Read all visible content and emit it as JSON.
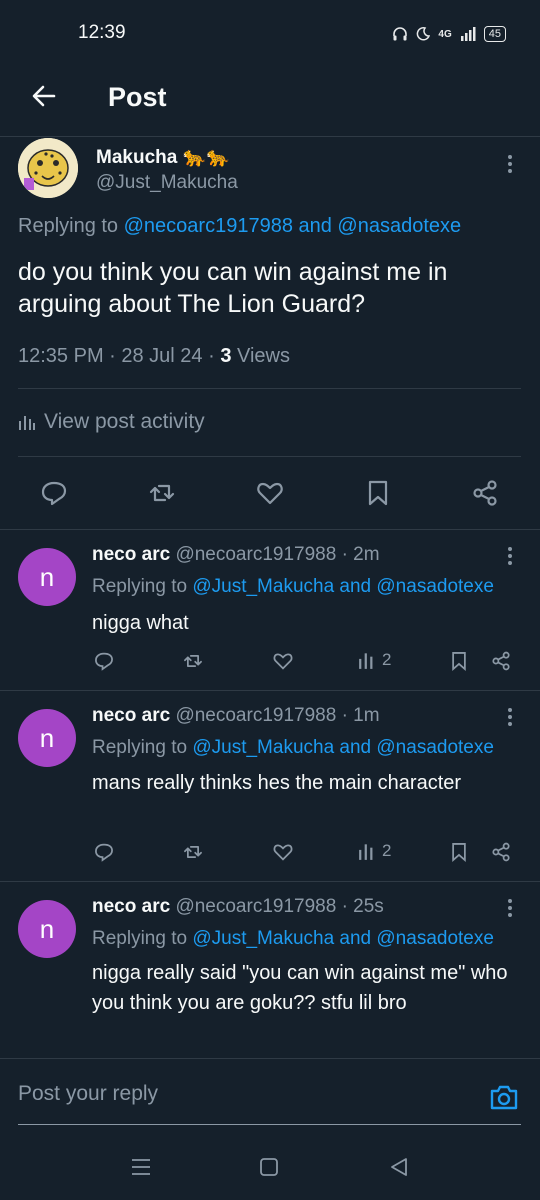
{
  "status_bar": {
    "time": "12:39",
    "network": "4G",
    "battery": "45"
  },
  "header": {
    "title": "Post",
    "back_icon": "back-arrow-icon"
  },
  "main_post": {
    "author_name": "Makucha 🐆🐆",
    "author_handle": "@Just_Makucha",
    "replying_prefix": "Replying to ",
    "replying_to": "@necoarc1917988 and @nasadotexe",
    "text": "do you think you can win against me in arguing about The Lion Guard?",
    "timestamp": "12:35 PM · 28 Jul 24 · ",
    "views_count": "3",
    "views_label": " Views",
    "activity_label": "View post activity"
  },
  "replies": [
    {
      "avatar_letter": "n",
      "name": "neco arc",
      "handle_time": "@necoarc1917988 · 2m",
      "replying_prefix": "Replying to ",
      "replying_to": "@Just_Makucha and @nasadotexe",
      "text": "nigga what",
      "views": "2"
    },
    {
      "avatar_letter": "n",
      "name": "neco arc",
      "handle_time": "@necoarc1917988 · 1m",
      "replying_prefix": "Replying to ",
      "replying_to": "@Just_Makucha and @nasadotexe",
      "text": "mans really thinks hes the main character",
      "views": "2"
    },
    {
      "avatar_letter": "n",
      "name": "neco arc",
      "handle_time": "@necoarc1917988 · 25s",
      "replying_prefix": "Replying to ",
      "replying_to": "@Just_Makucha and @nasadotexe",
      "text": "nigga really said \"you can win against me\" who you think you are goku?? stfu lil bro",
      "views": ""
    }
  ],
  "composer": {
    "placeholder": "Post your reply"
  },
  "colors": {
    "background": "#15202b",
    "accent": "#1d9bf0",
    "muted": "#8b98a5",
    "avatar": "#a445c6"
  }
}
